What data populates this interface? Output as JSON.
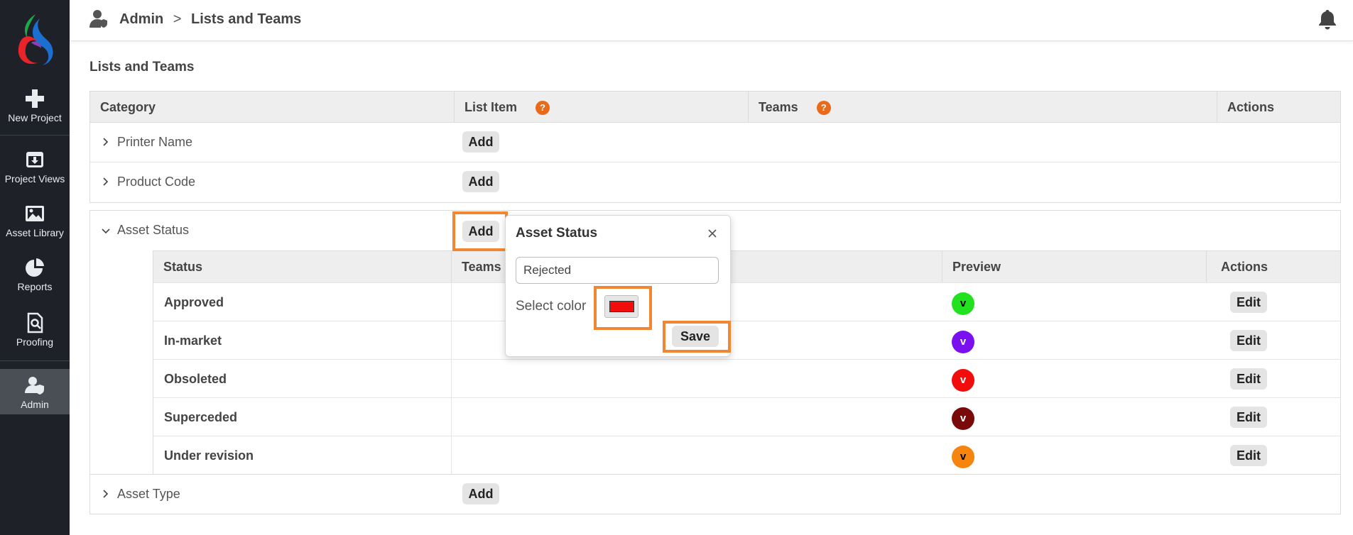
{
  "sidebar": {
    "items": [
      {
        "label": "New Project",
        "icon": "plus-icon"
      },
      {
        "label": "Project Views",
        "icon": "inbox-download-icon"
      },
      {
        "label": "Asset Library",
        "icon": "image-icon"
      },
      {
        "label": "Reports",
        "icon": "pie-chart-icon"
      },
      {
        "label": "Proofing",
        "icon": "document-search-icon"
      },
      {
        "label": "Admin",
        "icon": "user-shield-icon"
      }
    ]
  },
  "header": {
    "breadcrumb_root": "Admin",
    "breadcrumb_sep": ">",
    "breadcrumb_current": "Lists and Teams"
  },
  "page": {
    "title": "Lists and Teams"
  },
  "table": {
    "headers": {
      "category": "Category",
      "list_item": "List Item",
      "teams": "Teams",
      "actions": "Actions"
    },
    "help_glyph": "?",
    "rows": [
      {
        "label": "Printer Name",
        "add_label": "Add"
      },
      {
        "label": "Product Code",
        "add_label": "Add"
      }
    ]
  },
  "asset_status": {
    "label": "Asset Status",
    "add_label": "Add",
    "sub_headers": {
      "status": "Status",
      "teams": "Teams",
      "preview": "Preview",
      "actions": "Actions"
    },
    "items": [
      {
        "name": "Approved",
        "preview_letter": "v",
        "color": "#22e11f",
        "edit_label": "Edit"
      },
      {
        "name": "In-market",
        "preview_letter": "v",
        "color": "#7a0ff0",
        "edit_label": "Edit"
      },
      {
        "name": "Obsoleted",
        "preview_letter": "v",
        "color": "#f20d0d",
        "edit_label": "Edit"
      },
      {
        "name": "Superceded",
        "preview_letter": "v",
        "color": "#7a0a0a",
        "edit_label": "Edit"
      },
      {
        "name": "Under revision",
        "preview_letter": "v",
        "color": "#f5850f",
        "edit_label": "Edit"
      }
    ]
  },
  "asset_type": {
    "label": "Asset Type",
    "add_label": "Add"
  },
  "popover": {
    "title": "Asset Status",
    "input_value": "Rejected",
    "color_label": "Select color",
    "selected_color": "#f20d0d",
    "save_label": "Save"
  },
  "colors": {
    "sidebar_bg": "#1e2228",
    "highlight": "#f28733",
    "help_badge": "#e86a1a"
  }
}
